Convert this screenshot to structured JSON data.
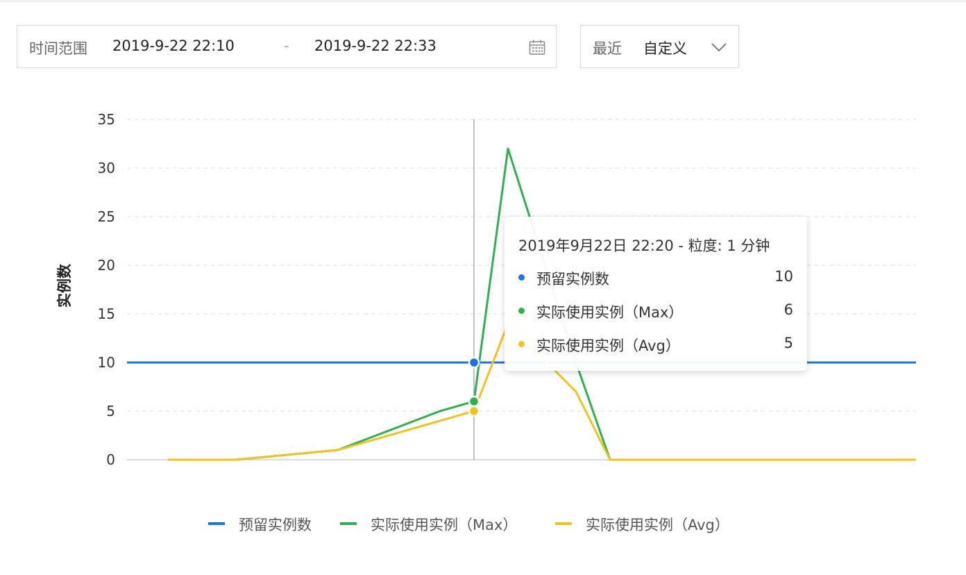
{
  "filter": {
    "range_label": "时间范围",
    "start": "2019-9-22 22:10",
    "separator": "-",
    "end": "2019-9-22 22:33",
    "recent_label": "最近",
    "recent_value": "自定义",
    "calendar_icon": "calendar-icon",
    "dropdown_icon": "chevron-down-icon"
  },
  "tooltip": {
    "title": "2019年9月22日 22:20 - 粒度: 1 分钟",
    "rows": [
      {
        "name": "预留实例数",
        "value": "10",
        "color": "#1a73e8"
      },
      {
        "name": "实际使用实例（Max）",
        "value": "6",
        "color": "#2db14f"
      },
      {
        "name": "实际使用实例（Avg）",
        "value": "5",
        "color": "#f2c31c"
      }
    ]
  },
  "legend": [
    {
      "name": "预留实例数",
      "color": "#1a73e8"
    },
    {
      "name": "实际使用实例（Max）",
      "color": "#2db14f"
    },
    {
      "name": "实际使用实例（Avg）",
      "color": "#f2c31c"
    }
  ],
  "chart_data": {
    "type": "line",
    "ylabel": "实例数",
    "ylim": [
      0,
      35
    ],
    "yticks": [
      0,
      5,
      10,
      15,
      20,
      25,
      30,
      35
    ],
    "xlim": [
      0,
      23
    ],
    "grid": true,
    "legend_position": "bottom",
    "x_axis_labels_shown": false,
    "hover_x": 10,
    "series": [
      {
        "name": "预留实例数",
        "color": "#1a73e8",
        "x": [
          0,
          23
        ],
        "values": [
          10,
          10
        ]
      },
      {
        "name": "实际使用实例（Max）",
        "color": "#2db14f",
        "x": [
          1,
          3,
          6,
          9,
          10,
          11,
          13,
          14,
          23
        ],
        "values": [
          0,
          0,
          1,
          5,
          6,
          32,
          10,
          0,
          0
        ]
      },
      {
        "name": "实际使用实例（Avg）",
        "color": "#f2c31c",
        "x": [
          1,
          3,
          6,
          9,
          10,
          11,
          13,
          14,
          23
        ],
        "values": [
          0,
          0,
          1,
          4,
          5,
          14,
          7,
          0,
          0
        ]
      }
    ]
  }
}
